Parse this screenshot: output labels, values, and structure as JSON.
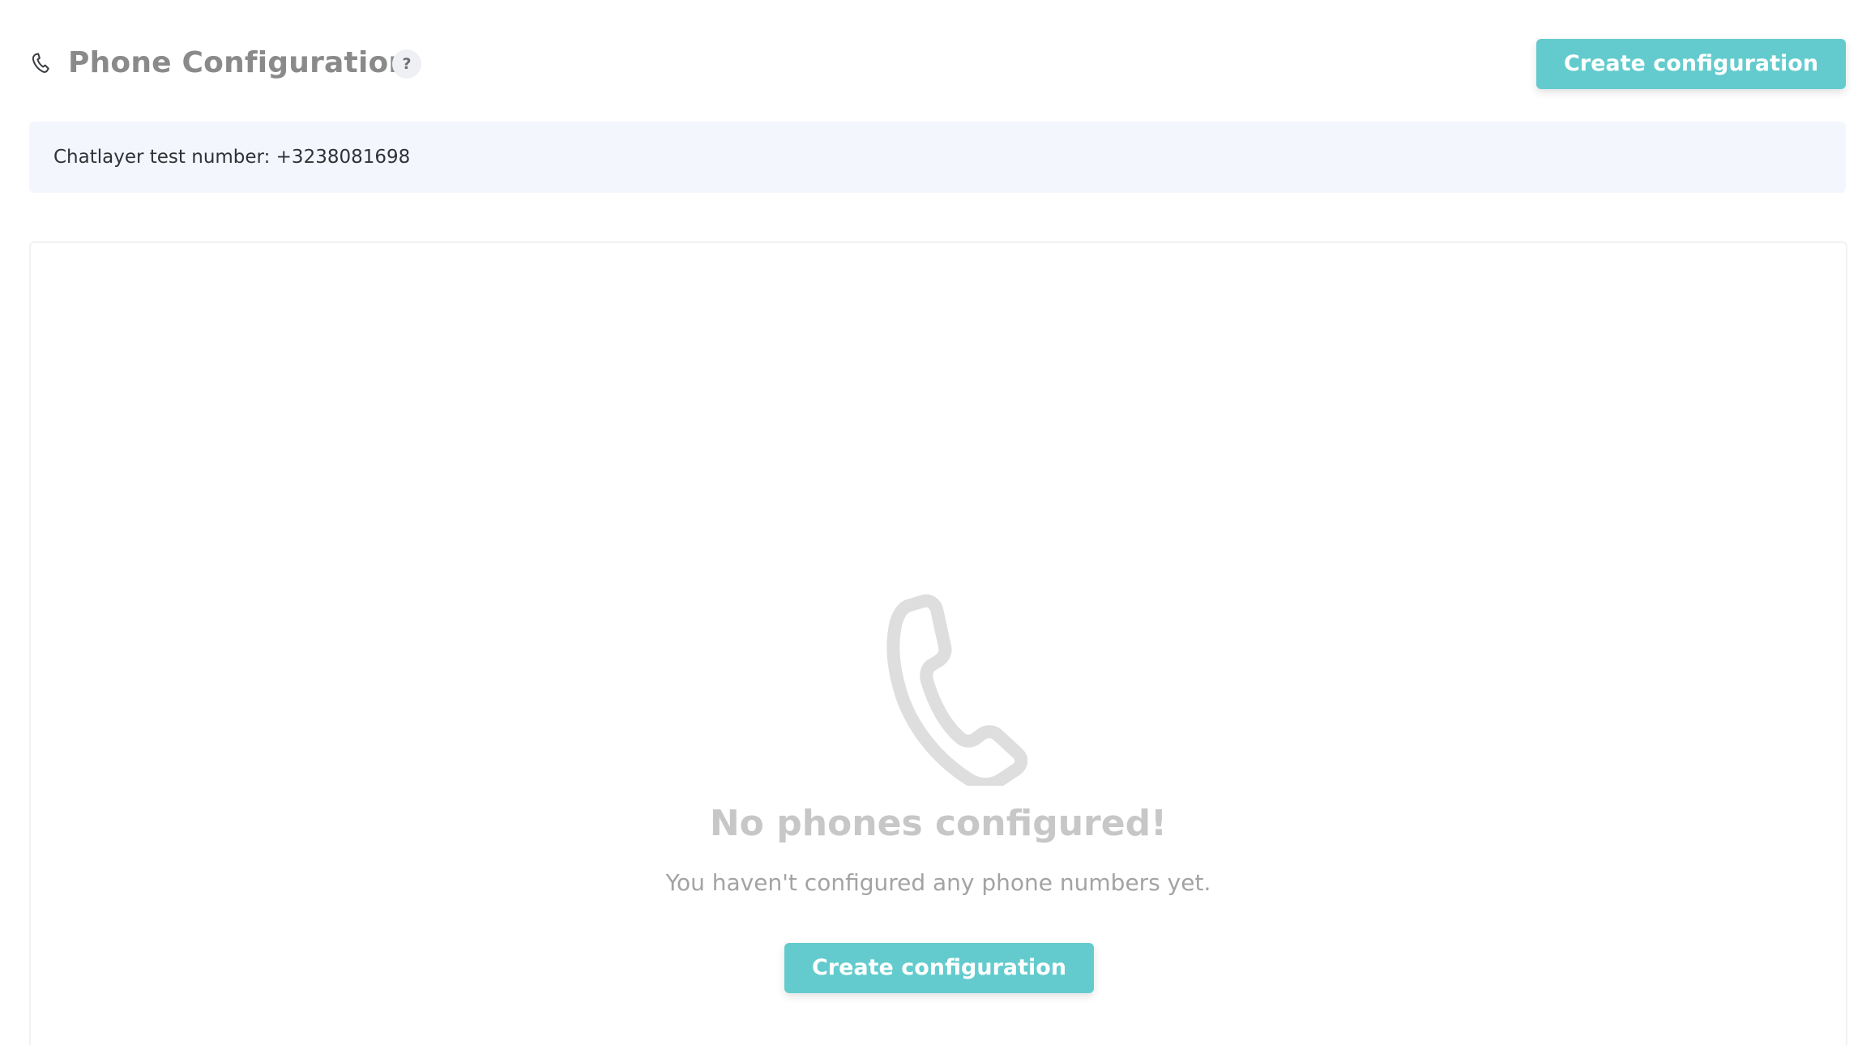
{
  "header": {
    "title": "Phone Configuration",
    "help_label": "?",
    "create_button_label": "Create configuration"
  },
  "info_bar": {
    "text": "Chatlayer test number: +3238081698"
  },
  "empty_state": {
    "icon": "phone-icon",
    "title": "No phones configured!",
    "subtitle": "You haven't configured any phone numbers yet.",
    "button_label": "Create configuration"
  },
  "colors": {
    "accent": "#63cbcd",
    "info_background": "#f3f7fd",
    "title_text": "#8a8a8a",
    "empty_icon": "#dedede"
  }
}
